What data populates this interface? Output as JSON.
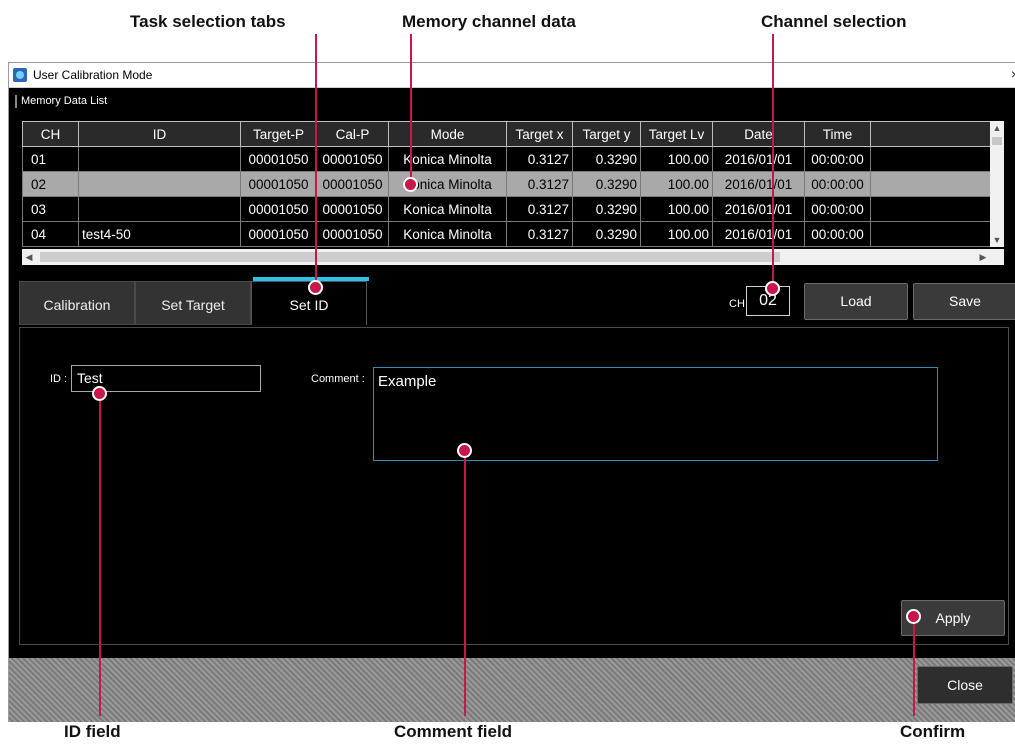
{
  "callouts": {
    "task_tabs": "Task selection tabs",
    "memory_data": "Memory channel data",
    "channel_selection": "Channel selection",
    "id_field": "ID field",
    "comment_field": "Comment field",
    "confirm": "Confirm"
  },
  "window": {
    "title": "User Calibration Mode",
    "close_glyph": "×",
    "section_title": "Memory Data List"
  },
  "table": {
    "headers": [
      "CH",
      "ID",
      "Target-P",
      "Cal-P",
      "Mode",
      "Target x",
      "Target y",
      "Target Lv",
      "Date",
      "Time"
    ],
    "rows": [
      {
        "ch": "01",
        "id": "",
        "target_p": "00001050",
        "cal_p": "00001050",
        "mode": "Konica Minolta",
        "tx": "0.3127",
        "ty": "0.3290",
        "lv": "100.00",
        "date": "2016/01/01",
        "time": "00:00:00"
      },
      {
        "ch": "02",
        "id": "",
        "target_p": "00001050",
        "cal_p": "00001050",
        "mode": "Konica Minolta",
        "tx": "0.3127",
        "ty": "0.3290",
        "lv": "100.00",
        "date": "2016/01/01",
        "time": "00:00:00"
      },
      {
        "ch": "03",
        "id": "",
        "target_p": "00001050",
        "cal_p": "00001050",
        "mode": "Konica Minolta",
        "tx": "0.3127",
        "ty": "0.3290",
        "lv": "100.00",
        "date": "2016/01/01",
        "time": "00:00:00"
      },
      {
        "ch": "04",
        "id": "test4-50",
        "target_p": "00001050",
        "cal_p": "00001050",
        "mode": "Konica Minolta",
        "tx": "0.3127",
        "ty": "0.3290",
        "lv": "100.00",
        "date": "2016/01/01",
        "time": "00:00:00"
      }
    ],
    "selected_row": 1
  },
  "tabs": {
    "calibration": "Calibration",
    "set_target": "Set Target",
    "set_id": "Set ID",
    "active": "Set ID"
  },
  "channel": {
    "label": "CH :",
    "value": "02"
  },
  "buttons": {
    "load": "Load",
    "save": "Save",
    "apply": "Apply",
    "close": "Close"
  },
  "form": {
    "id_label": "ID :",
    "id_value": "Test",
    "comment_label": "Comment :",
    "comment_value": "Example"
  },
  "colors": {
    "accent_tab": "#2ec2e8",
    "marker": "#c8174a",
    "selected_row": "#a9a9a9"
  }
}
